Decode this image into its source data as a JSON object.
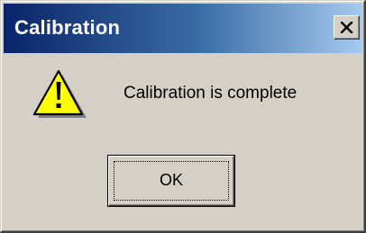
{
  "window": {
    "title": "Calibration",
    "close_icon": "close-icon",
    "colors": {
      "titlebar_start": "#0a246a",
      "titlebar_end": "#a6caf0",
      "face": "#d4d0c8"
    }
  },
  "body": {
    "icon": "warning-icon",
    "icon_color": "#ffff00",
    "message": "Calibration is complete"
  },
  "buttons": {
    "ok_label": "OK"
  }
}
